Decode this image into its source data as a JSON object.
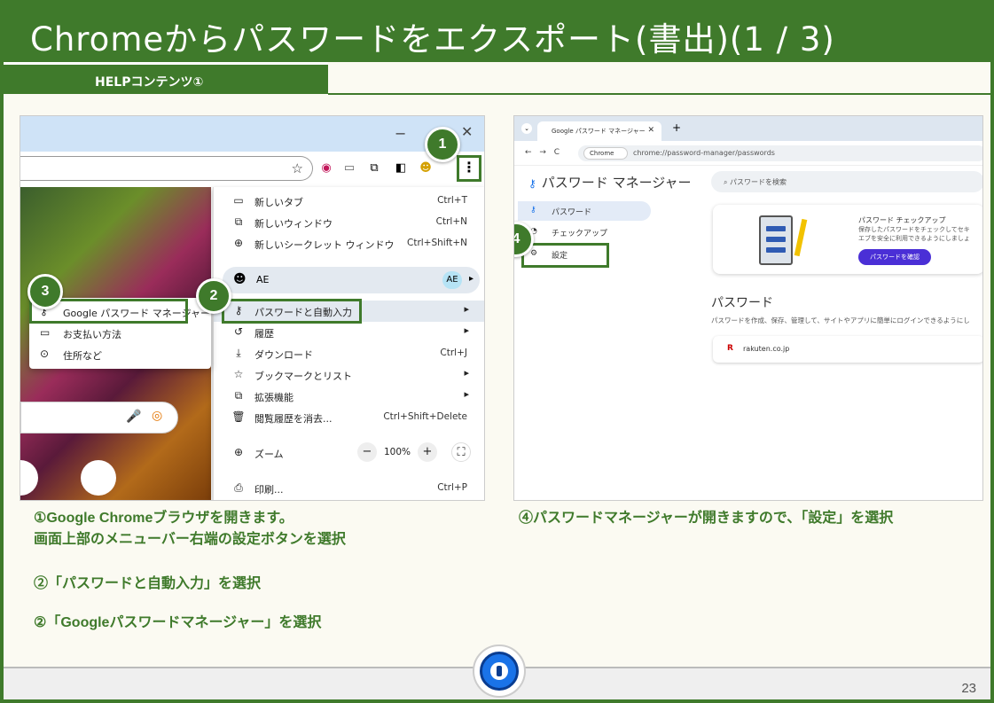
{
  "slide": {
    "title": "Chromeからパスワードをエクスポート(書出)(1 / 3)",
    "subtitle": "HELPコンテンツ①",
    "page_number": "23",
    "accent_color": "#3f7a2b"
  },
  "left_screenshot": {
    "window_controls": {
      "minimize": "−",
      "close": "✕"
    },
    "menu_items": [
      {
        "icon": "new-tab-icon",
        "label": "新しいタブ",
        "shortcut": "Ctrl+T"
      },
      {
        "icon": "new-window-icon",
        "label": "新しいウィンドウ",
        "shortcut": "Ctrl+N"
      },
      {
        "icon": "incognito-icon",
        "label": "新しいシークレット ウィンドウ",
        "shortcut": "Ctrl+Shift+N"
      },
      {
        "icon": "key-icon",
        "label": "パスワードと自動入力",
        "shortcut": "▸"
      },
      {
        "icon": "history-icon",
        "label": "履歴",
        "shortcut": "▸"
      },
      {
        "icon": "download-icon",
        "label": "ダウンロード",
        "shortcut": "Ctrl+J"
      },
      {
        "icon": "star-icon",
        "label": "ブックマークとリスト",
        "shortcut": "▸"
      },
      {
        "icon": "extension-icon",
        "label": "拡張機能",
        "shortcut": "▸"
      },
      {
        "icon": "trash-icon",
        "label": "閲覧履歴を消去...",
        "shortcut": "Ctrl+Shift+Delete"
      },
      {
        "icon": "print-icon",
        "label": "印刷...",
        "shortcut": "Ctrl+P"
      }
    ],
    "profile": {
      "name": "AE",
      "badge": "AE"
    },
    "zoom": {
      "label": "ズーム",
      "minus": "−",
      "value": "100%",
      "plus": "+"
    },
    "submenu_items": [
      {
        "icon": "key-icon",
        "label": "Google パスワード マネージャー"
      },
      {
        "icon": "card-icon",
        "label": "お支払い方法"
      },
      {
        "icon": "location-icon",
        "label": "住所など"
      }
    ]
  },
  "right_screenshot": {
    "tab_title": "Google パスワード マネージャー",
    "tab_close": "✕",
    "new_tab": "+",
    "nav": "← → C",
    "url_chip": "Chrome",
    "url": "chrome://password-manager/passwords",
    "brand": "パスワード マネージャー",
    "search_placeholder": "パスワードを検索",
    "sidebar": [
      {
        "label": "パスワード",
        "active": true
      },
      {
        "label": "チェックアップ",
        "active": false
      },
      {
        "label": "設定",
        "active": false
      }
    ],
    "checkup_card": {
      "title": "パスワード チェックアップ",
      "text_line1": "保存したパスワードをチェックしてセキ",
      "text_line2": "エブを安全に利用できるようにしましょ",
      "button": "パスワードを確認"
    },
    "section_title": "パスワード",
    "section_desc": "パスワードを作成、保存、管理して、サイトやアプリに簡単にログインできるようにし",
    "entries": [
      {
        "icon": "R",
        "label": "rakuten.co.jp"
      }
    ]
  },
  "callouts": [
    "1",
    "2",
    "3",
    "4"
  ],
  "descriptions": {
    "left_line1": "①Google Chromeブラウザを開きます。",
    "left_line2": "画面上部のメニューバー右端の設定ボタンを選択",
    "left_step2": "②「パスワードと自動入力」を選択",
    "left_step3": "②「Googleパスワードマネージャー」を選択",
    "right_step4": "④パスワードマネージャーが開きますので、「設定」を選択"
  }
}
